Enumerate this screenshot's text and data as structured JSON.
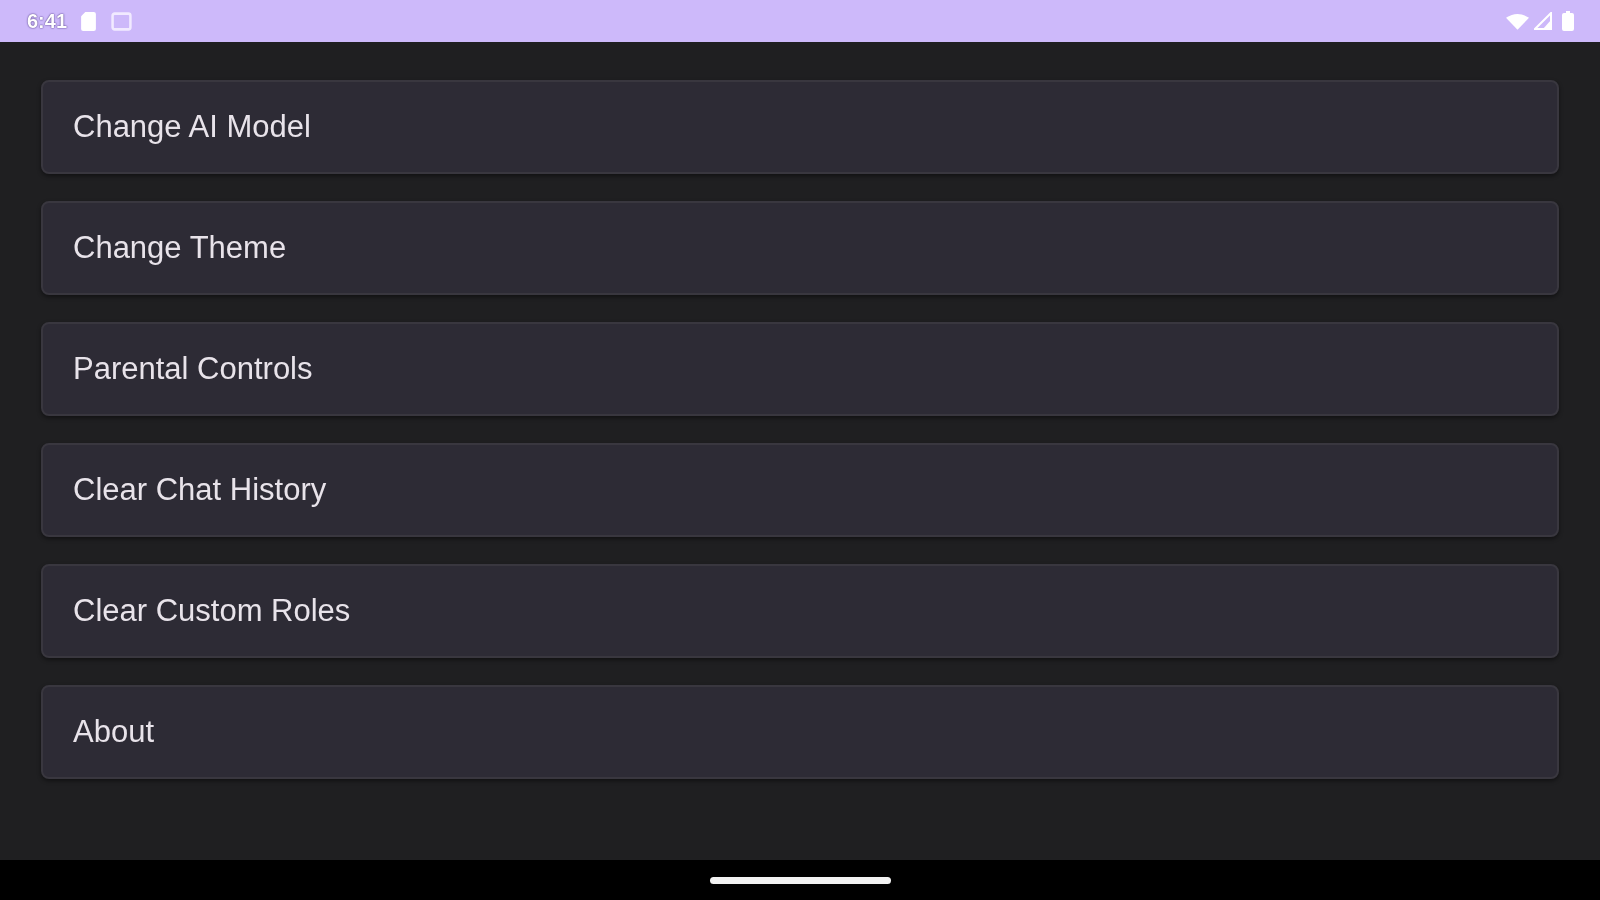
{
  "status_bar": {
    "time": "6:41"
  },
  "settings_items": [
    {
      "label": "Change AI Model"
    },
    {
      "label": "Change Theme"
    },
    {
      "label": "Parental Controls"
    },
    {
      "label": "Clear Chat History"
    },
    {
      "label": "Clear Custom Roles"
    },
    {
      "label": "About"
    }
  ]
}
